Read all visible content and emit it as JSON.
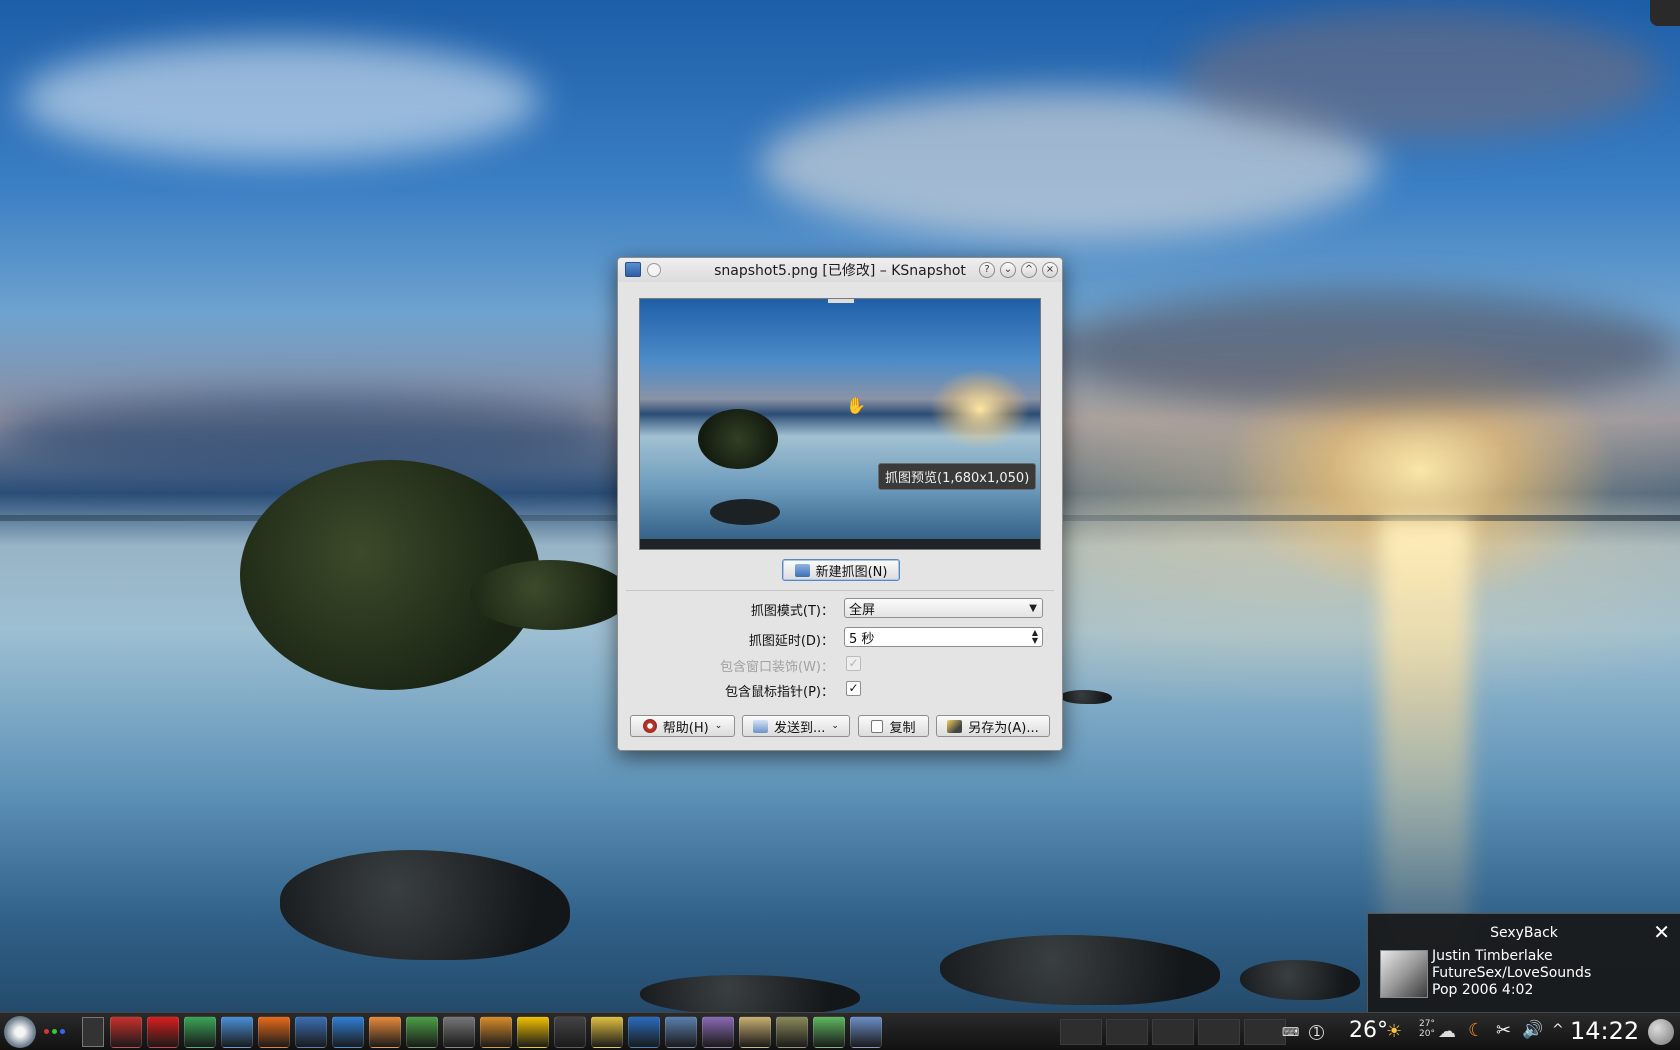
{
  "window": {
    "title": "snapshot5.png [已修改] – KSnapshot",
    "title_buttons": [
      "?",
      "⌄",
      "^",
      "×"
    ]
  },
  "preview": {
    "tooltip": "抓图预览(1,680x1,050)"
  },
  "buttons": {
    "new_snapshot": "新建抓图(N)",
    "help": "帮助(H)",
    "send_to": "发送到...",
    "copy": "复制",
    "save_as": "另存为(A)..."
  },
  "form": {
    "mode_label": "抓图模式(T)：",
    "mode_value": "全屏",
    "delay_label": "抓图延时(D)：",
    "delay_value": "5 秒",
    "decorations_label": "包含窗口装饰(W)：",
    "decorations_checked": true,
    "pointer_label": "包含鼠标指针(P)：",
    "pointer_checked": true
  },
  "now_playing": {
    "title": "SexyBack",
    "artist": "Justin Timberlake",
    "album": "FutureSex/LoveSounds",
    "meta": "Pop 2006 4:02"
  },
  "taskbar": {
    "temperature": "26°",
    "temp_high": "27°",
    "temp_low": "20°",
    "clock": "14:22",
    "desktop_number": "1",
    "app_icon_colors": [
      "#c9302c",
      "#d81e1e",
      "#3aa657",
      "#4a90d9",
      "#e86b1a",
      "#3b6fb5",
      "#2f7fd6",
      "#e88a3c",
      "#4ca046",
      "#777777",
      "#d98c2a",
      "#f2c200",
      "#444444",
      "#e0c040",
      "#2a6bbf",
      "#5a7fae",
      "#8a6ab5",
      "#c8b070",
      "#8a8a5a",
      "#5fb85f",
      "#6a8fc8"
    ]
  }
}
